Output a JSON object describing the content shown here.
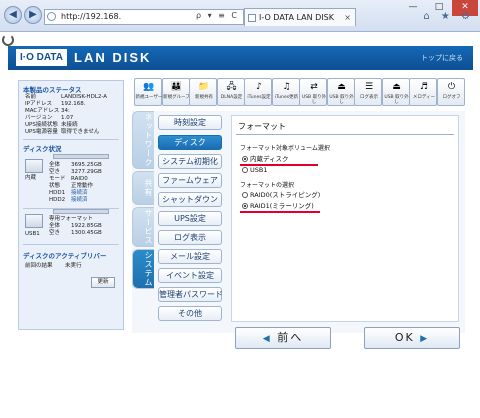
{
  "browser": {
    "address": "http://192.168.",
    "tab_title": "I-O DATA LAN DISK",
    "back_glyph": "◀",
    "forward_glyph": "▶",
    "addr_tools": "ρ ▾ ≡ C",
    "tab_close": "×",
    "min_glyph": "—",
    "max_glyph": "□",
    "close_glyph": "✕",
    "right_icons": "⌂ ★ ⚙"
  },
  "header": {
    "logo": "I·O DATA",
    "product": "LAN DISK",
    "top_link": "トップに戻る"
  },
  "status": {
    "title": "本製品のステータス",
    "rows": [
      {
        "k": "名前",
        "v": "LANDISK-HDL2-A"
      },
      {
        "k": "IPアドレス",
        "v": "192.168."
      },
      {
        "k": "MACアドレス",
        "v": "34:"
      },
      {
        "k": "バージョン",
        "v": "1.07"
      },
      {
        "k": "UPS接続状態",
        "v": "未接続"
      },
      {
        "k": "UPS電源容量",
        "v": "取得できません"
      }
    ]
  },
  "disk": {
    "title": "ディスク状況",
    "internal_label": "内蔵",
    "internal_rows": [
      {
        "k": "全体",
        "v": "3695.25GB"
      },
      {
        "k": "空き",
        "v": "3277.29GB"
      },
      {
        "k": "モード",
        "v": "RAID0"
      },
      {
        "k": "状態",
        "v": "正常動作"
      },
      {
        "k": "HDD1",
        "v": "接続済"
      },
      {
        "k": "HDD2",
        "v": "接続済"
      }
    ],
    "usb_label": "USB1",
    "usb_rows": [
      {
        "k": "専用フォーマット",
        "v": ""
      },
      {
        "k": "全体",
        "v": "1922.85GB"
      },
      {
        "k": "空き",
        "v": "1300.45GB"
      }
    ]
  },
  "activity": {
    "title": "ディスクのアクティブリバー",
    "row_k": "前回の結果",
    "row_v": "未実行",
    "refresh": "更新"
  },
  "toolbar": [
    {
      "label": "新規ユーザー",
      "icon": "👥"
    },
    {
      "label": "新規グループ",
      "icon": "👪"
    },
    {
      "label": "新規共有",
      "icon": "📁"
    },
    {
      "label": "DLNA設定",
      "icon": "🖧"
    },
    {
      "label": "iTunes設定",
      "icon": "♪"
    },
    {
      "label": "iTunes更新",
      "icon": "♫"
    },
    {
      "label": "USB\n取り外し",
      "icon": "⇄"
    },
    {
      "label": "USB\n取り外し",
      "icon": "⏏"
    },
    {
      "label": "ログ表示",
      "icon": "☰"
    },
    {
      "label": "USB\n取り外し",
      "icon": "⏏"
    },
    {
      "label": "メロディー",
      "icon": "♬"
    },
    {
      "label": "ログオフ",
      "icon": "⏻"
    }
  ],
  "vtabs": [
    {
      "label": "ネットワーク",
      "state": "inactive"
    },
    {
      "label": "共有",
      "state": "inactive"
    },
    {
      "label": "サービス",
      "state": "inactive"
    },
    {
      "label": "システム",
      "state": "active"
    }
  ],
  "menu": [
    {
      "label": "時刻設定",
      "state": "normal"
    },
    {
      "label": "ディスク",
      "state": "active"
    },
    {
      "label": "システム初期化",
      "state": "normal"
    },
    {
      "label": "ファームウェア",
      "state": "normal"
    },
    {
      "label": "シャットダウン",
      "state": "normal"
    },
    {
      "label": "UPS設定",
      "state": "normal"
    },
    {
      "label": "ログ表示",
      "state": "normal"
    },
    {
      "label": "メール設定",
      "state": "normal"
    },
    {
      "label": "イベント設定",
      "state": "normal"
    },
    {
      "label": "管理者パスワード",
      "state": "normal"
    },
    {
      "label": "その他",
      "state": "normal"
    }
  ],
  "content": {
    "title": "フォーマット",
    "volume_label": "フォーマット対象ボリューム選択",
    "volume_options": [
      {
        "label": "内蔵ディスク",
        "selected": true
      },
      {
        "label": "USB1",
        "selected": false
      }
    ],
    "format_label": "フォーマットの選択",
    "format_options": [
      {
        "label": "RAID0(ストライピング)",
        "selected": false
      },
      {
        "label": "RAID1(ミラーリング)",
        "selected": true
      }
    ],
    "prev": "前へ",
    "prev_arrow": "◀",
    "ok": "OK",
    "ok_arrow": "▶"
  },
  "colors": {
    "accent": "#1a6cb0",
    "header": "#0d4f94",
    "highlight": "#e0002a"
  }
}
